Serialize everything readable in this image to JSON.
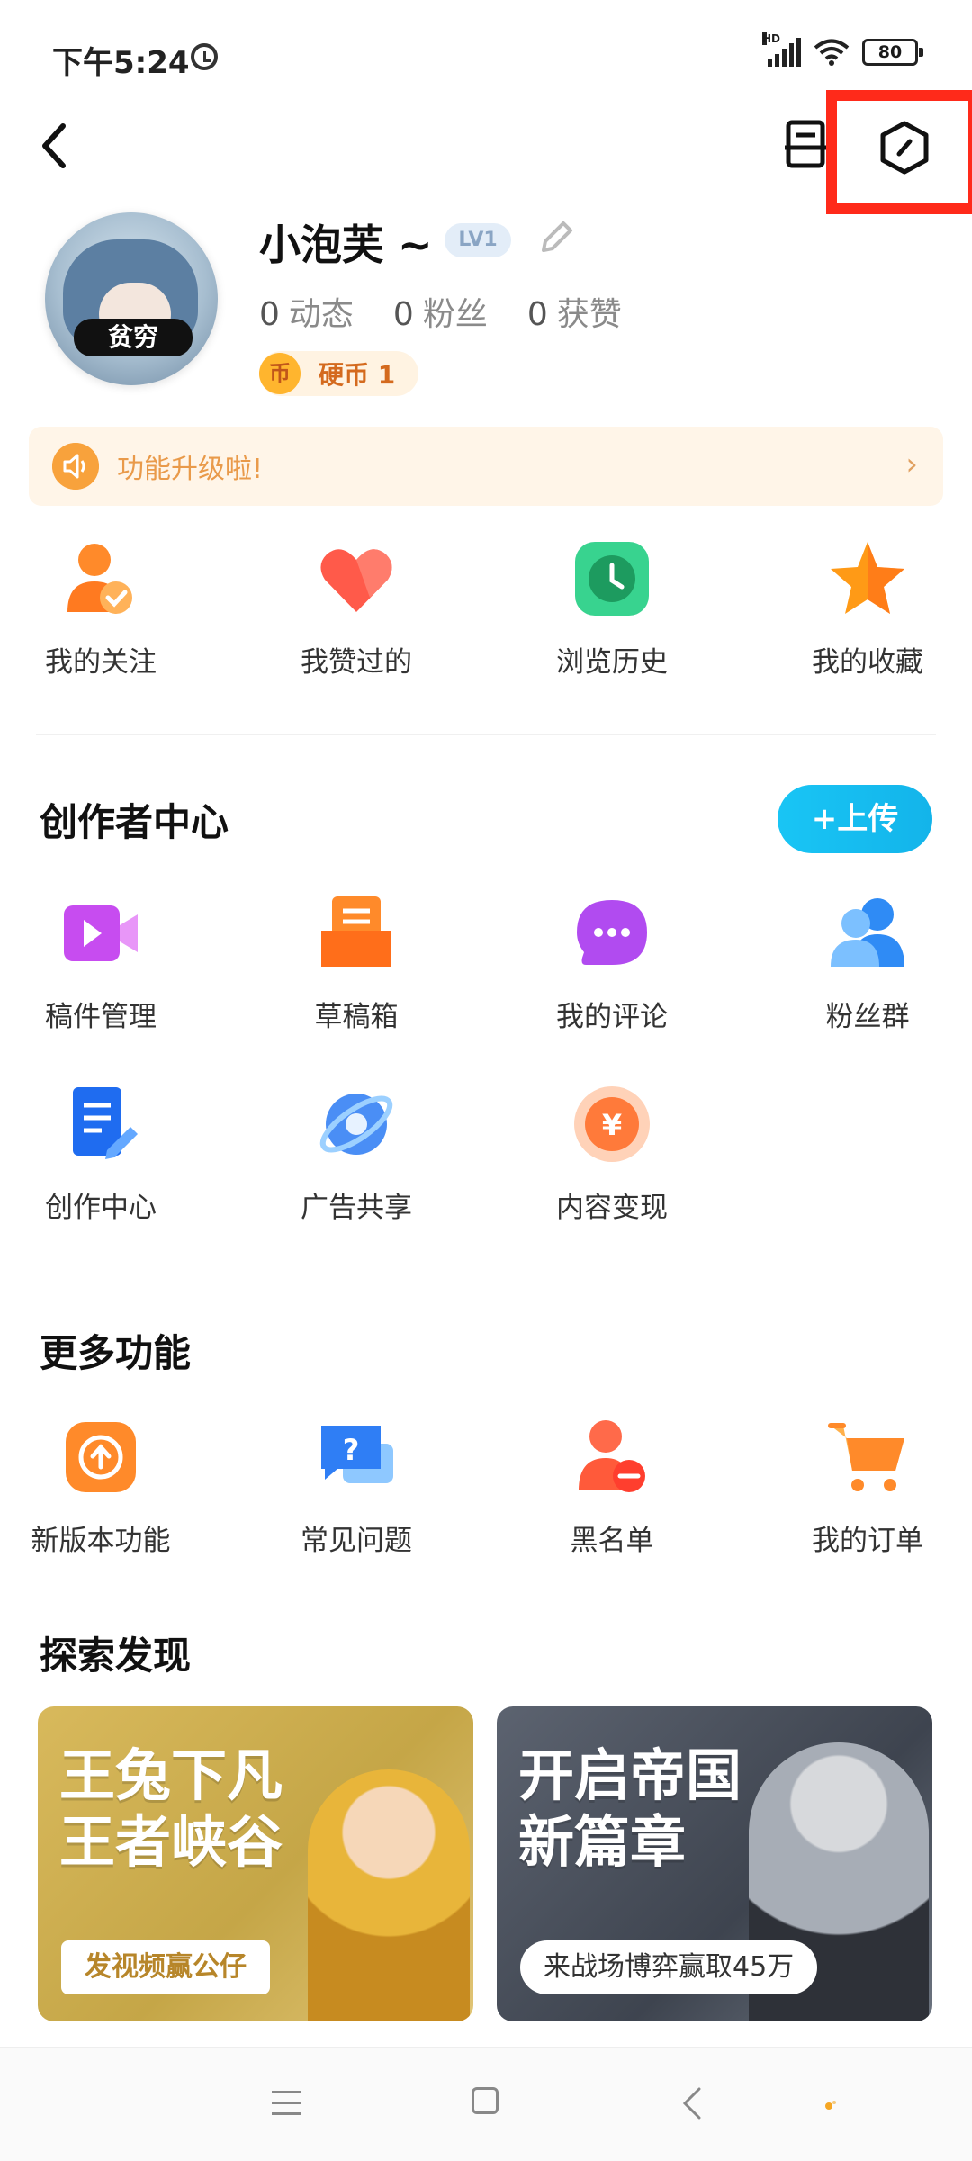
{
  "status_bar": {
    "time": "下午5:24",
    "network": "HD",
    "battery": "80"
  },
  "header": {
    "back_icon": "back-icon",
    "message_icon": "inbox-icon",
    "settings_icon": "settings-hexagon-icon",
    "highlight_color": "#ff2a1a"
  },
  "profile": {
    "avatar_label": "贫穷",
    "username": "小泡芙 ~",
    "level": "LV1",
    "stats": [
      {
        "count": "0",
        "label": "动态"
      },
      {
        "count": "0",
        "label": "粉丝"
      },
      {
        "count": "0",
        "label": "获赞"
      }
    ],
    "coin_symbol": "币",
    "coins": "硬币 1"
  },
  "notice": {
    "text": "功能升级啦!",
    "arrow": "›"
  },
  "quick_items": [
    {
      "label": "我的关注",
      "icon": "follow-icon"
    },
    {
      "label": "我赞过的",
      "icon": "heart-icon"
    },
    {
      "label": "浏览历史",
      "icon": "clock-icon"
    },
    {
      "label": "我的收藏",
      "icon": "star-icon"
    }
  ],
  "creator": {
    "title": "创作者中心",
    "upload_label": "+上传",
    "items": [
      {
        "label": "稿件管理",
        "icon": "video-icon"
      },
      {
        "label": "草稿箱",
        "icon": "drafts-icon"
      },
      {
        "label": "我的评论",
        "icon": "comment-icon"
      },
      {
        "label": "粉丝群",
        "icon": "group-icon"
      },
      {
        "label": "创作中心",
        "icon": "document-icon"
      },
      {
        "label": "广告共享",
        "icon": "planet-icon"
      },
      {
        "label": "内容变现",
        "icon": "yuan-coin-icon"
      }
    ]
  },
  "more": {
    "title": "更多功能",
    "items": [
      {
        "label": "新版本功能",
        "icon": "update-icon"
      },
      {
        "label": "常见问题",
        "icon": "faq-icon"
      },
      {
        "label": "黑名单",
        "icon": "blacklist-icon"
      },
      {
        "label": "我的订单",
        "icon": "cart-icon"
      }
    ]
  },
  "discover": {
    "title": "探索发现",
    "cards": [
      {
        "title_line1": "王兔下凡",
        "title_line2": "王者峡谷",
        "pill": "发视频赢公仔"
      },
      {
        "title_line1": "开启帝国",
        "title_line2": "新篇章",
        "pill": "来战场博弈赢取45万"
      }
    ]
  }
}
